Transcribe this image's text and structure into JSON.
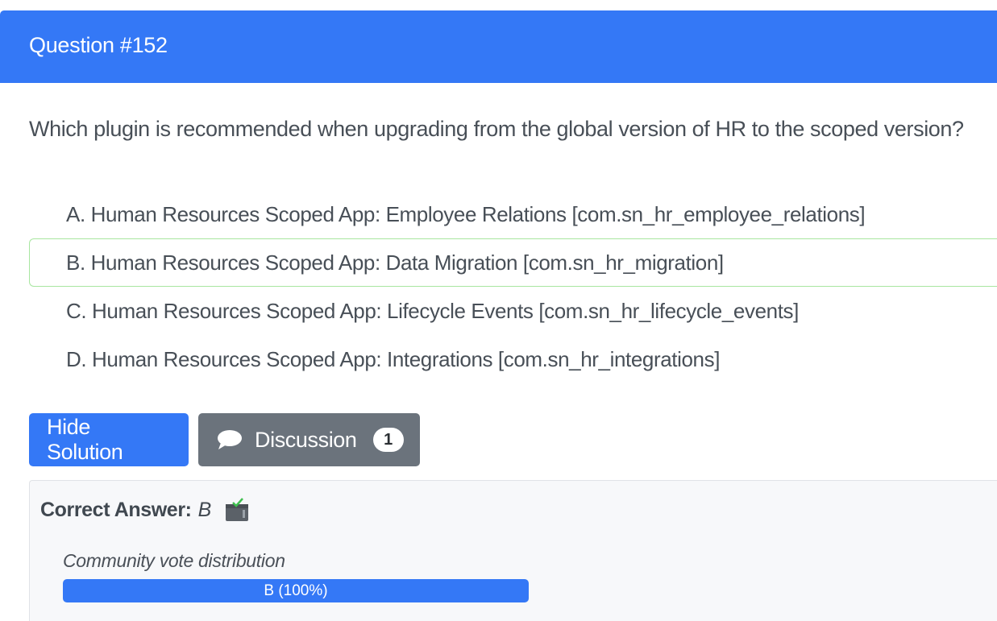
{
  "header": {
    "title": "Question #152"
  },
  "question": {
    "text": "Which plugin is recommended when upgrading from the global version of HR to the scoped version?"
  },
  "choices": [
    {
      "letter": "A.",
      "text": "A. Human Resources Scoped App: Employee Relations [com.sn_hr_employee_relations]",
      "highlighted": false
    },
    {
      "letter": "B.",
      "text": "B. Human Resources Scoped App: Data Migration [com.sn_hr_migration]",
      "highlighted": true
    },
    {
      "letter": "C.",
      "text": "C. Human Resources Scoped App: Lifecycle Events [com.sn_hr_lifecycle_events]",
      "highlighted": false
    },
    {
      "letter": "D.",
      "text": "D. Human Resources Scoped App: Integrations [com.sn_hr_integrations]",
      "highlighted": false
    }
  ],
  "buttons": {
    "hide_solution": "Hide Solution",
    "discussion": "Discussion",
    "discussion_count": "1"
  },
  "solution": {
    "correct_label": "Correct Answer:",
    "correct_value": "B",
    "vote_label": "Community vote distribution",
    "vote_bar_text": "B (100%)",
    "vote_fraction": 1.0
  },
  "colors": {
    "primary": "#3478f6",
    "secondary": "#6b737c",
    "correct_border": "#a8e6a0"
  },
  "icons": {
    "discussion": "chat-bubble-icon",
    "answer": "clipboard-check-icon"
  }
}
